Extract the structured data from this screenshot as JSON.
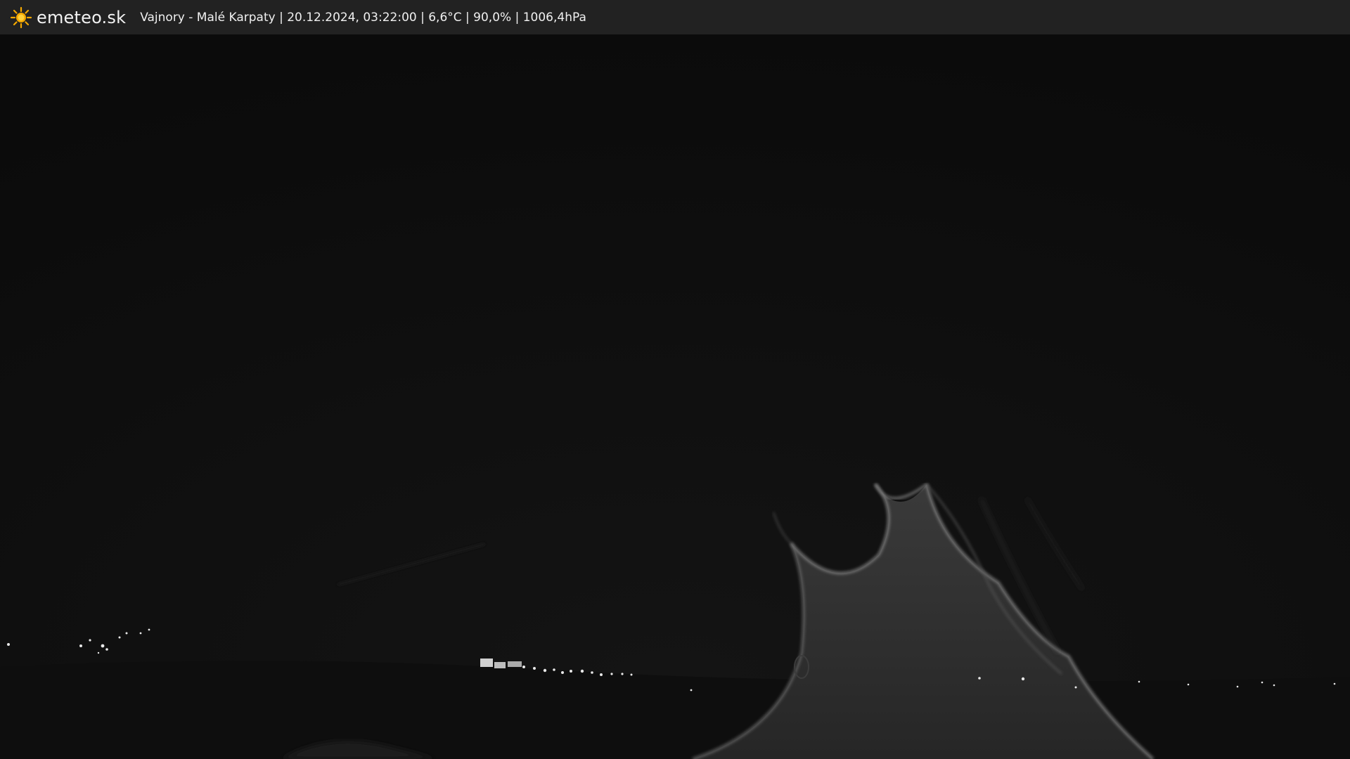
{
  "header": {
    "brand": "emeteo.sk",
    "info": "Vajnory - Malé Karpaty | 20.12.2024, 03:22:00 | 6,6°C | 90,0% | 1006,4hPa",
    "logo_icon": "sun-icon"
  },
  "colors": {
    "topbar_bg": "#222222",
    "sun": "#f5a800",
    "sky": "#0c0c0c"
  }
}
